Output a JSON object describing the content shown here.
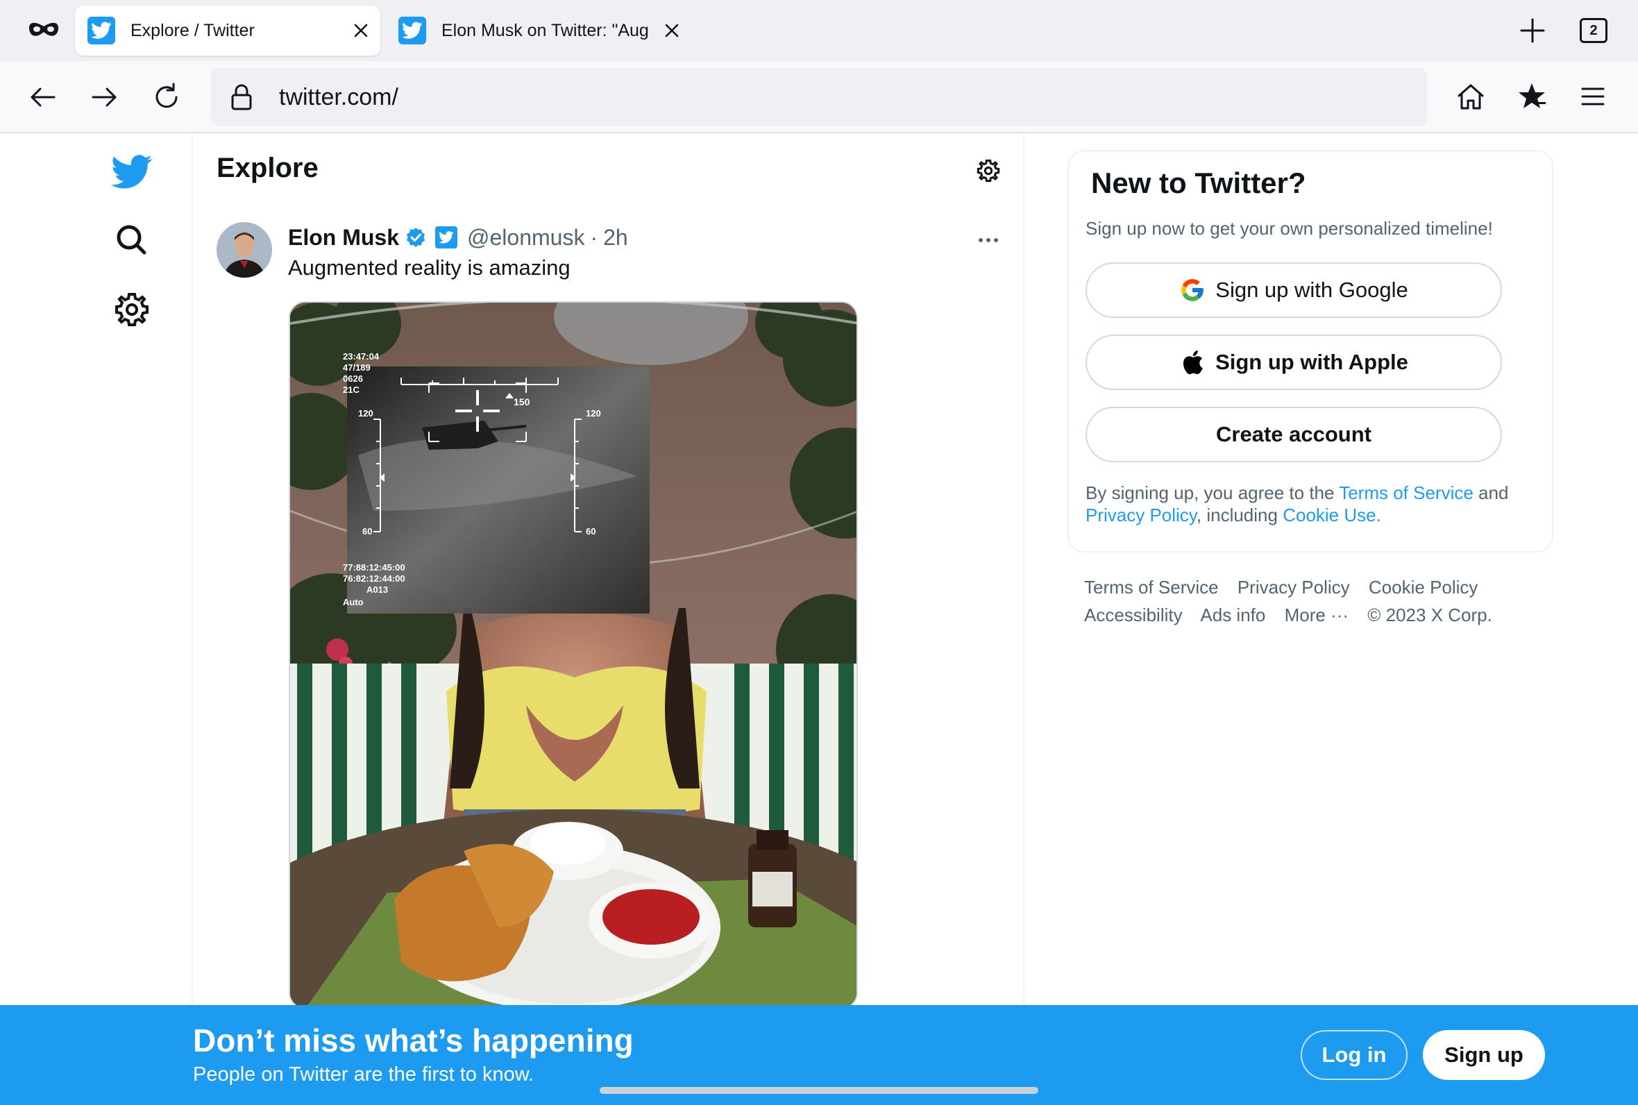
{
  "browser": {
    "tabs": [
      {
        "title": "Explore / Twitter",
        "active": true,
        "favicon": "twitter-bird-icon"
      },
      {
        "title": "Elon Musk on Twitter: \"Aug",
        "active": false,
        "favicon": "twitter-bird-icon"
      }
    ],
    "tab_count": "2",
    "url": "twitter.com/"
  },
  "left_nav": {
    "items": [
      "twitter-logo-icon",
      "search-icon",
      "settings-icon"
    ]
  },
  "main": {
    "title": "Explore",
    "tweet": {
      "author_name": "Elon Musk",
      "handle": "@elonmusk",
      "separator": "·",
      "time": "2h",
      "text": "Augmented reality is amazing",
      "hud": {
        "top_left": [
          "23:47:04",
          "47/189",
          "0626",
          "21C"
        ],
        "scale_top": "120",
        "scale_bottom": "60",
        "compass_value": "150",
        "right_top": "120",
        "right_bottom": "60",
        "bottom_left": [
          "77:88:12:45:00",
          "76:82:12:44:00",
          "A013",
          "Auto"
        ]
      }
    }
  },
  "signup_card": {
    "title": "New to Twitter?",
    "subtitle": "Sign up now to get your own personalized timeline!",
    "google_label": "Sign up with Google",
    "apple_label": "Sign up with Apple",
    "create_label": "Create account",
    "terms_prefix": "By signing up, you agree to the ",
    "terms_link": "Terms of Service",
    "terms_and": " and ",
    "privacy_link": "Privacy Policy",
    "terms_including": ", including ",
    "cookie_link": "Cookie Use",
    "terms_end": "."
  },
  "footer": {
    "links": [
      "Terms of Service",
      "Privacy Policy",
      "Cookie Policy",
      "Accessibility",
      "Ads info",
      "More ···",
      "© 2023 X Corp."
    ]
  },
  "banner": {
    "title": "Don’t miss what’s happening",
    "subtitle": "People on Twitter are the first to know.",
    "login_label": "Log in",
    "signup_label": "Sign up"
  },
  "colors": {
    "twitter_blue": "#1d9bf0",
    "text_primary": "#0f1419",
    "text_secondary": "#536471"
  }
}
